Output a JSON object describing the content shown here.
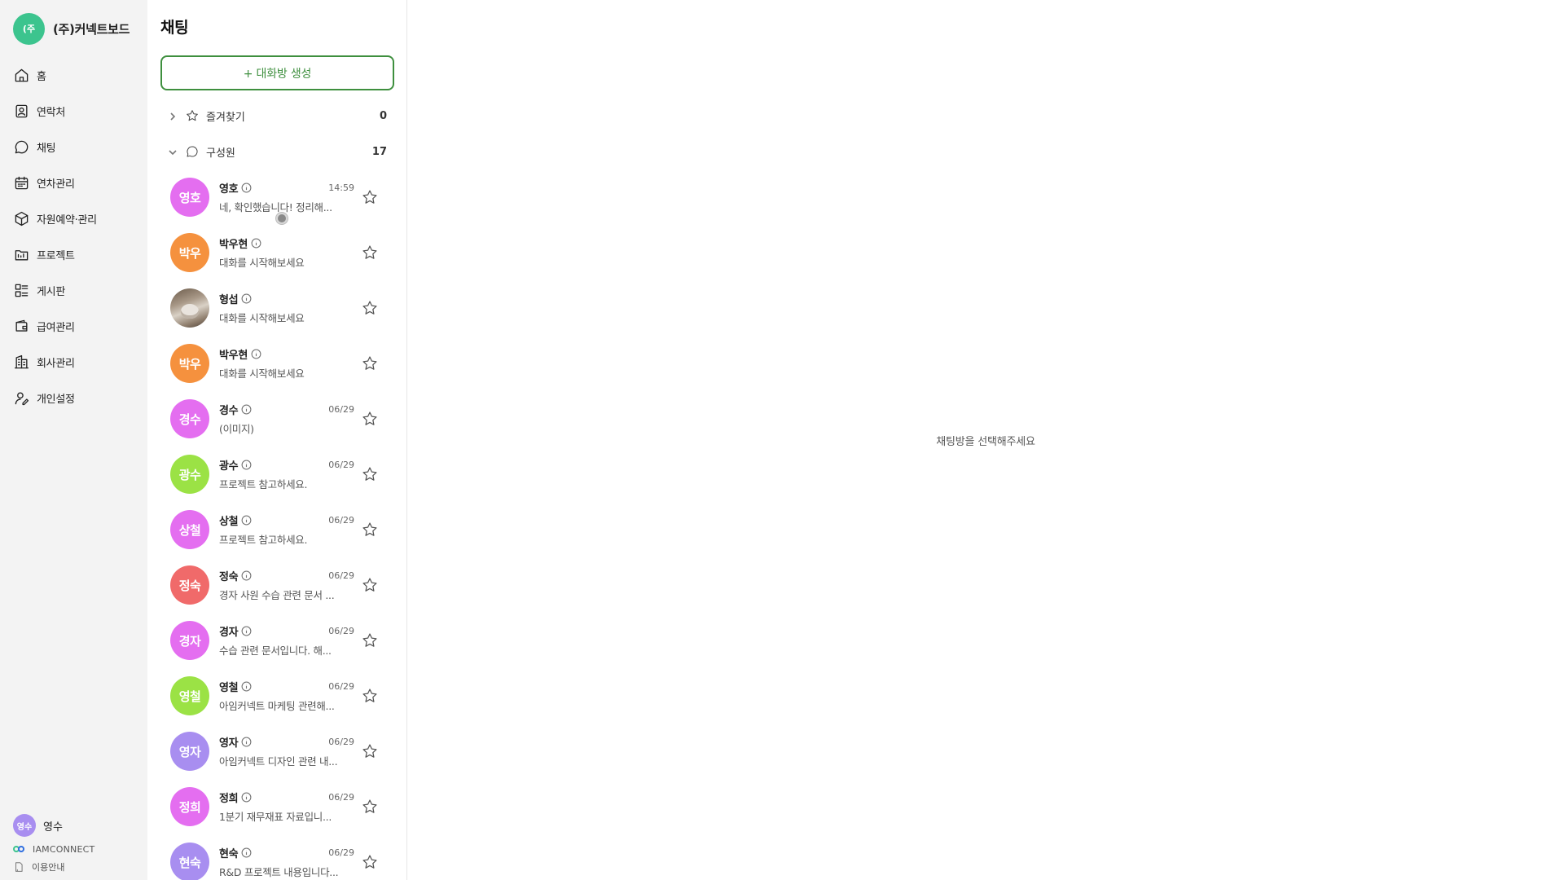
{
  "brand": {
    "logo_text": "(주",
    "name": "(주)커넥트보드"
  },
  "nav": [
    {
      "label": "홈",
      "icon": "home-icon"
    },
    {
      "label": "연락처",
      "icon": "contact-book-icon"
    },
    {
      "label": "채팅",
      "icon": "chat-bubble-icon"
    },
    {
      "label": "연차관리",
      "icon": "calendar-icon"
    },
    {
      "label": "자원예약·관리",
      "icon": "box-icon"
    },
    {
      "label": "프로젝트",
      "icon": "project-folder-icon"
    },
    {
      "label": "게시판",
      "icon": "board-list-icon"
    },
    {
      "label": "급여관리",
      "icon": "wallet-icon"
    },
    {
      "label": "회사관리",
      "icon": "building-icon"
    },
    {
      "label": "개인설정",
      "icon": "user-settings-icon"
    }
  ],
  "current_user": {
    "avatar_text": "영수",
    "name": "영수"
  },
  "footer": {
    "brand": "IAMCONNECT",
    "guide": "이용안내"
  },
  "chat_panel": {
    "title": "채팅",
    "create_button": "+ 대화방 생성",
    "favorites": {
      "label": "즐겨찾기",
      "count": "0"
    },
    "members": {
      "label": "구성원",
      "count": "17"
    }
  },
  "chats": [
    {
      "avatar_text": "영호",
      "avatar_color": "#e46ef0",
      "name": "영호",
      "time": "14:59",
      "preview": "네, 확인했습니다! 정리해..."
    },
    {
      "avatar_text": "박우",
      "avatar_color": "#f5913e",
      "name": "박우현",
      "time": "",
      "preview": "대화를 시작해보세요"
    },
    {
      "avatar_text": "",
      "avatar_color": "",
      "avatar_photo": true,
      "name": "형섭",
      "time": "",
      "preview": "대화를 시작해보세요"
    },
    {
      "avatar_text": "박우",
      "avatar_color": "#f5913e",
      "name": "박우현",
      "time": "",
      "preview": "대화를 시작해보세요"
    },
    {
      "avatar_text": "경수",
      "avatar_color": "#e46ef0",
      "name": "경수",
      "time": "06/29",
      "preview": "(이미지)"
    },
    {
      "avatar_text": "광수",
      "avatar_color": "#9be245",
      "name": "광수",
      "time": "06/29",
      "preview": "프로젝트 참고하세요."
    },
    {
      "avatar_text": "상철",
      "avatar_color": "#e46ef0",
      "name": "상철",
      "time": "06/29",
      "preview": "프로젝트 참고하세요."
    },
    {
      "avatar_text": "정숙",
      "avatar_color": "#f06a6a",
      "name": "정숙",
      "time": "06/29",
      "preview": "경자 사원 수습 관련 문서 ..."
    },
    {
      "avatar_text": "경자",
      "avatar_color": "#e46ef0",
      "name": "경자",
      "time": "06/29",
      "preview": "수습 관련 문서입니다. 해..."
    },
    {
      "avatar_text": "영철",
      "avatar_color": "#9be245",
      "name": "영철",
      "time": "06/29",
      "preview": "아임커넥트 마케팅 관련해..."
    },
    {
      "avatar_text": "영자",
      "avatar_color": "#a88ef0",
      "name": "영자",
      "time": "06/29",
      "preview": "아임커넥트 디자인 관련 내..."
    },
    {
      "avatar_text": "정희",
      "avatar_color": "#e46ef0",
      "name": "정희",
      "time": "06/29",
      "preview": "1분기 재무재표 자료입니..."
    },
    {
      "avatar_text": "현숙",
      "avatar_color": "#a88ef0",
      "name": "현숙",
      "time": "06/29",
      "preview": "R&D 프로젝트 내용입니다..."
    }
  ],
  "main": {
    "empty_message": "채팅방을 선택해주세요"
  }
}
